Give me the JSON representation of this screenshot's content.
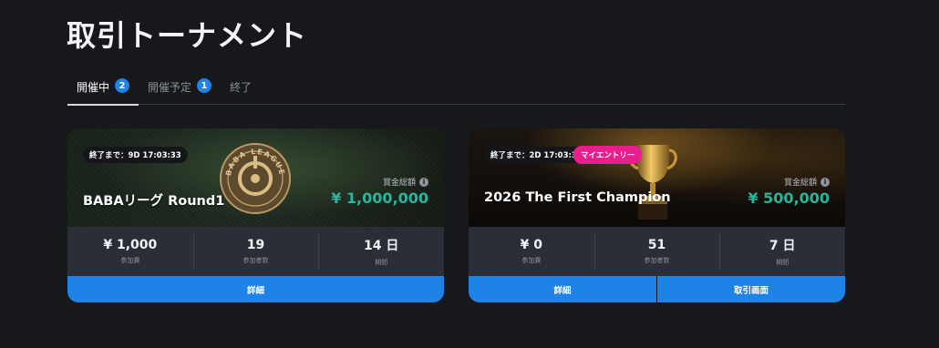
{
  "page": {
    "title": "取引トーナメント"
  },
  "tabs": [
    {
      "label": "開催中",
      "badge": "2",
      "active": true
    },
    {
      "label": "開催予定",
      "badge": "1",
      "active": false
    },
    {
      "label": "終了",
      "badge": "",
      "active": false
    }
  ],
  "colors": {
    "accent": "#1e82e6",
    "prize": "#2bb39b",
    "entry_badge": "#e91e8c",
    "background": "#17181c"
  },
  "cards": [
    {
      "countdown": "終了まで：9D 17:03:33",
      "title": "BABAリーグ Round1",
      "emblem_text": "BABA LEAGUE",
      "prize_label": "賞金総額",
      "prize": "¥ 1,000,000",
      "stats": [
        {
          "value": "¥ 1,000",
          "label": "参加費"
        },
        {
          "value": "19",
          "label": "参加者数"
        },
        {
          "value": "14 日",
          "label": "期間"
        }
      ],
      "actions": [
        "詳細"
      ]
    },
    {
      "countdown": "終了まで：2D 17:03:33",
      "entry_badge": "マイエントリー",
      "title": "2026 The First Champion",
      "prize_label": "賞金総額",
      "prize": "¥ 500,000",
      "stats": [
        {
          "value": "¥ 0",
          "label": "参加費"
        },
        {
          "value": "51",
          "label": "参加者数"
        },
        {
          "value": "7 日",
          "label": "期間"
        }
      ],
      "actions": [
        "詳細",
        "取引画面"
      ]
    }
  ]
}
